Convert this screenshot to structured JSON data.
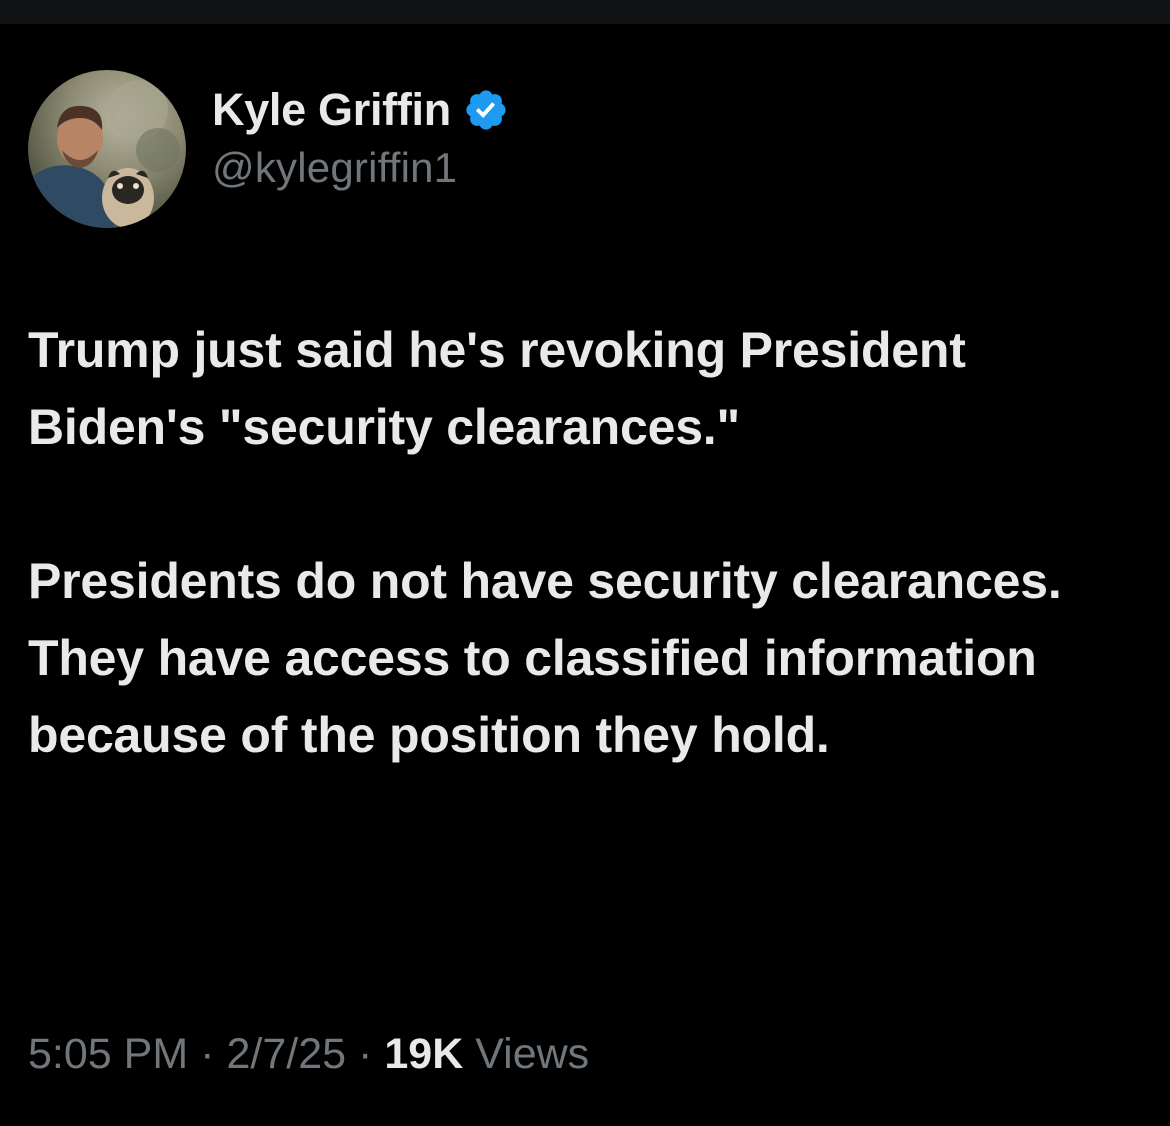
{
  "tweet": {
    "author": {
      "display_name": "Kyle Griffin",
      "handle": "@kylegriffin1",
      "verified": true,
      "avatar_icon": "profile-photo"
    },
    "paragraphs": [
      "Trump just said he's revoking President Biden's \"security clearances.\"",
      "Presidents do not have security clearances. They have access to classified information because of the position they hold."
    ],
    "meta": {
      "time": "5:05 PM",
      "date": "2/7/25",
      "views_count": "19K",
      "views_label": "Views",
      "separator": "·"
    }
  },
  "colors": {
    "background": "#000000",
    "primary_text": "#e7e9ea",
    "secondary_text": "#71767b",
    "verified_badge": "#1d9bf0"
  }
}
